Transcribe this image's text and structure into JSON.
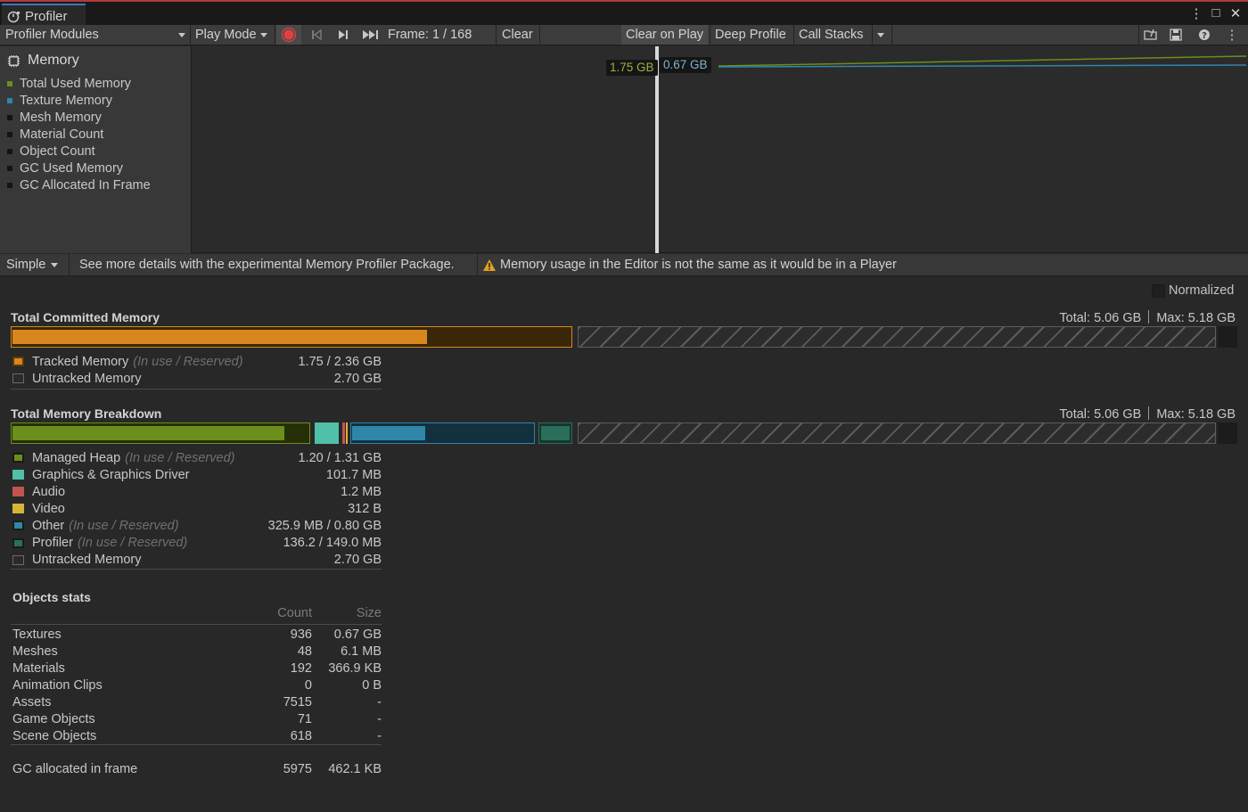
{
  "window": {
    "tab_title": "Profiler",
    "more_icon": "⋮",
    "maximize_icon": "□",
    "close_icon": "✕"
  },
  "toolbar": {
    "modules_label": "Profiler Modules",
    "play_mode_label": "Play Mode",
    "frame_label": "Frame: 1 / 168",
    "clear_label": "Clear",
    "clear_on_play_label": "Clear on Play",
    "deep_profile_label": "Deep Profile",
    "call_stacks_label": "Call Stacks"
  },
  "modules": {
    "title": "Memory",
    "items": [
      {
        "label": "Total Used Memory",
        "color": "#6b8e1d"
      },
      {
        "label": "Texture Memory",
        "color": "#2f86a8"
      },
      {
        "label": "Mesh Memory",
        "color": "#141414"
      },
      {
        "label": "Material Count",
        "color": "#141414"
      },
      {
        "label": "Object Count",
        "color": "#141414"
      },
      {
        "label": "GC Used Memory",
        "color": "#141414"
      },
      {
        "label": "GC Allocated In Frame",
        "color": "#141414"
      }
    ]
  },
  "chart": {
    "used_label": "1.75 GB",
    "texture_label": "0.67 GB"
  },
  "subbar": {
    "view_mode": "Simple",
    "hint": "See more details with the experimental Memory Profiler Package.",
    "warning": "Memory usage in the Editor is not the same as it would be in a Player"
  },
  "details": {
    "normalized_label": "Normalized",
    "committed": {
      "title": "Total Committed Memory",
      "total_text": "Total: 5.06 GB",
      "max_text": "Max: 5.18 GB",
      "tracked_label": "Tracked Memory",
      "tracked_sub": "(In use / Reserved)",
      "tracked_value": "1.75 / 2.36 GB",
      "untracked_label": "Untracked Memory",
      "untracked_value": "2.70 GB"
    },
    "breakdown": {
      "title": "Total Memory Breakdown",
      "total_text": "Total: 5.06 GB",
      "max_text": "Max: 5.18 GB",
      "rows": [
        {
          "label": "Managed Heap",
          "sub": "(In use / Reserved)",
          "value": "1.20 / 1.31 GB",
          "color": "#6b8e1d"
        },
        {
          "label": "Graphics & Graphics Driver",
          "sub": "",
          "value": "101.7 MB",
          "color": "#4fbfa8"
        },
        {
          "label": "Audio",
          "sub": "",
          "value": "1.2 MB",
          "color": "#c4534f"
        },
        {
          "label": "Video",
          "sub": "",
          "value": "312 B",
          "color": "#d6b43a"
        },
        {
          "label": "Other",
          "sub": "(In use / Reserved)",
          "value": "325.9 MB / 0.80 GB",
          "color": "#2f86a8"
        },
        {
          "label": "Profiler",
          "sub": "(In use / Reserved)",
          "value": "136.2 / 149.0 MB",
          "color": "#2b6e5c"
        },
        {
          "label": "Untracked Memory",
          "sub": "",
          "value": "2.70 GB",
          "color": "#2a2a2a"
        }
      ]
    },
    "objects": {
      "title": "Objects stats",
      "col_count": "Count",
      "col_size": "Size",
      "rows": [
        {
          "label": "Textures",
          "count": "936",
          "size": "0.67 GB"
        },
        {
          "label": "Meshes",
          "count": "48",
          "size": "6.1 MB"
        },
        {
          "label": "Materials",
          "count": "192",
          "size": "366.9 KB"
        },
        {
          "label": "Animation Clips",
          "count": "0",
          "size": "0 B"
        },
        {
          "label": "Assets",
          "count": "7515",
          "size": "-"
        },
        {
          "label": "Game Objects",
          "count": "71",
          "size": "-"
        },
        {
          "label": "Scene Objects",
          "count": "618",
          "size": "-"
        }
      ],
      "gc_label": "GC allocated in frame",
      "gc_count": "5975",
      "gc_size": "462.1 KB"
    }
  }
}
